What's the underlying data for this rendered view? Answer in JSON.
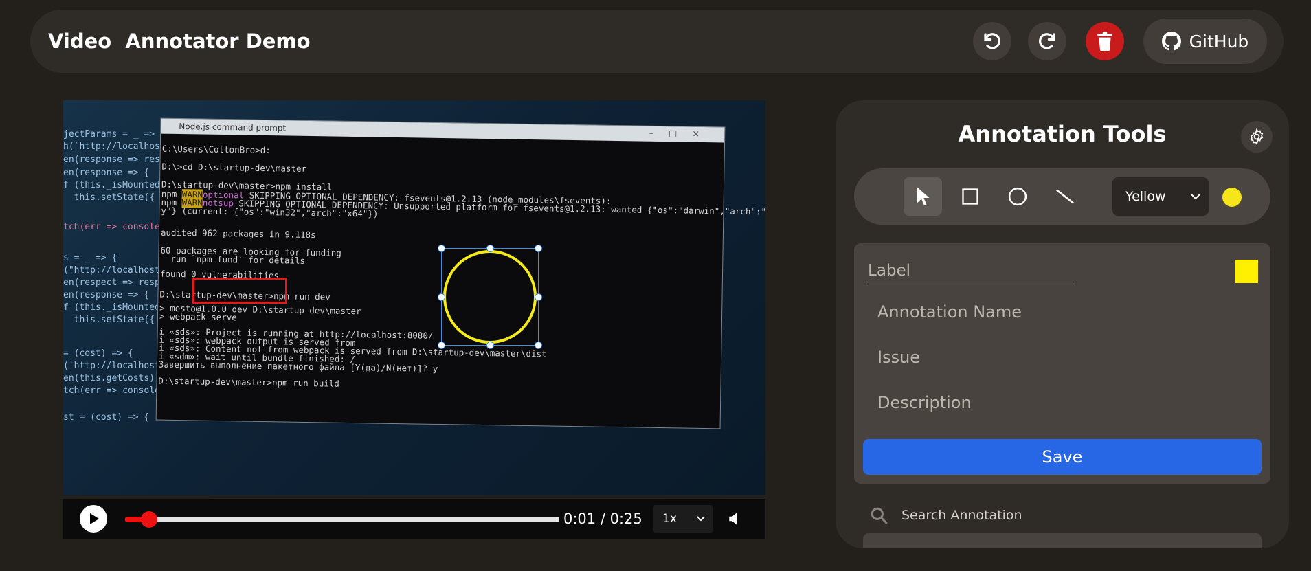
{
  "header": {
    "title": "Video  Annotator Demo",
    "github_label": "GitHub",
    "icons": [
      "undo-icon",
      "redo-icon",
      "trash-icon",
      "github-icon"
    ]
  },
  "video": {
    "terminal_title": "Node.js command prompt",
    "terminal_lines": [
      "C:\\Users\\CottonBro>d:",
      "D:\\>cd D:\\startup-dev\\master",
      "D:\\startup-dev\\master>npm install",
      "audited 962 packages in 9.118s",
      "60 packages are looking for funding",
      "  run `npm fund` for details",
      "found 0 vulnerabilities",
      "D:\\startup-dev\\master>npm run dev",
      "> mesto@1.0.0 dev D:\\startup-dev\\master",
      "> webpack serve",
      "i «sds»: Project is running at http://localhost:8080/",
      "i «sds»: webpack output is served from",
      "i «sds»: Content not from webpack is served from D:\\startup-dev\\master\\dist",
      "i «sdm»: wait until bundle finished: /",
      "Завершить выполнение пакетного файла [Y(да)/N(нет)]? y",
      "D:\\startup-dev\\master>npm run build"
    ],
    "warn_lines": [
      {
        "prefix": "npm ",
        "badge": "WARN",
        "tag": "optional",
        "text": " SKIPPING OPTIONAL DEPENDENCY: fsevents@1.2.13 (node_modules\\fsevents):"
      },
      {
        "prefix": "npm ",
        "badge": "WARN",
        "tag": "notsup",
        "text": " SKIPPING OPTIONAL DEPENDENCY: Unsupported platform for fsevents@1.2.13: wanted {\"os\":\"darwin\",\"arch\":\"an"
      },
      {
        "prefix": "",
        "badge": "",
        "tag": "",
        "text": "y\"} (current: {\"os\":\"win32\",\"arch\":\"x64\"})"
      }
    ],
    "code_left": [
      "jectParams = _ => {",
      "h(`http://localhost:",
      "en(response => resp",
      "en(response => {",
      "f (this._isMounted)",
      "  this.setState({ pr",
      "tch(err => console.",
      "s = _ => {",
      "(\"http://localhost:",
      "en(respect => respo",
      "en(response => {",
      "f (this._isMounted)",
      "  this.setState({ pr",
      "= (cost) => {",
      "(`http://localhost:",
      "en(this.getCosts)",
      "tch(err => console.error(err))",
      "st = (cost) => {"
    ]
  },
  "player": {
    "current_time": "0:01",
    "separator": "/",
    "duration": "0:25",
    "progress": 0.04,
    "speed": "1x"
  },
  "tools": {
    "title": "Annotation Tools",
    "tool_icons": [
      "pointer-icon",
      "rectangle-icon",
      "circle-icon",
      "line-icon"
    ],
    "color_select": "Yellow",
    "active_color": "#f5e51a"
  },
  "form": {
    "label_placeholder": "Label",
    "name_placeholder": "Annotation Name",
    "issue_placeholder": "Issue",
    "description_placeholder": "Description",
    "save_label": "Save",
    "swatch_color": "#ffef00"
  },
  "search": {
    "placeholder": "Search Annotation"
  }
}
